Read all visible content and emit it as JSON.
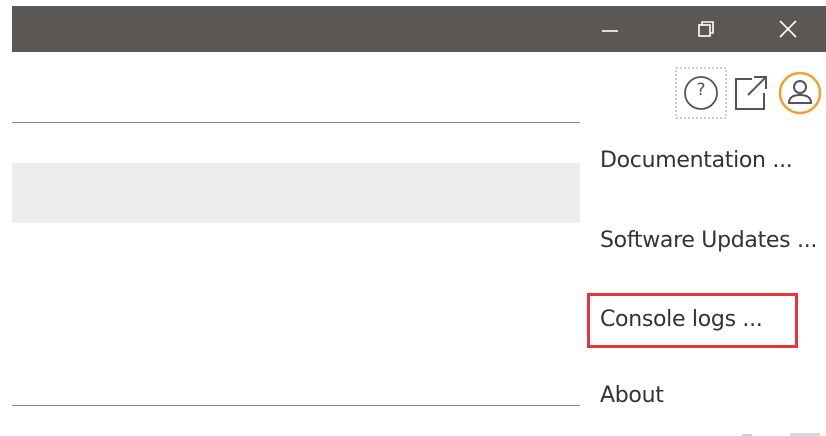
{
  "window": {
    "controls": [
      {
        "name": "minimize",
        "icon": "minimize-icon"
      },
      {
        "name": "restore",
        "icon": "restore-icon"
      },
      {
        "name": "close",
        "icon": "close-icon"
      }
    ]
  },
  "toolbar": {
    "icons": [
      "help-icon",
      "external-link-icon",
      "user-icon"
    ],
    "help_symbol": "?",
    "accent_color": "#f0a030"
  },
  "menu": {
    "items": [
      {
        "label": "Documentation ..."
      },
      {
        "label": "Software Updates ..."
      },
      {
        "label": "Console logs ..."
      },
      {
        "label": "About"
      }
    ],
    "highlight_color": "#e8343a"
  }
}
